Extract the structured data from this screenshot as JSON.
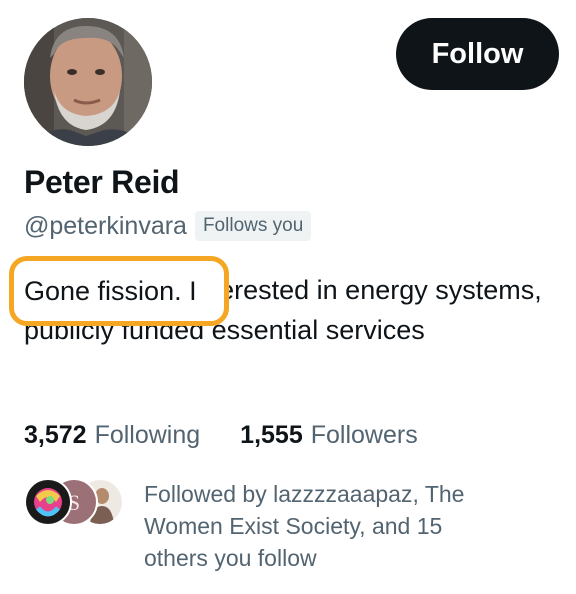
{
  "profile": {
    "display_name": "Peter Reid",
    "handle": "@peterkinvara",
    "follows_you_badge": "Follows you",
    "bio": "Gone fission. Interested in energy systems, publicly funded essential services",
    "highlight_text": "Gone fission. I",
    "avatar_icon": "profile-photo"
  },
  "actions": {
    "follow_label": "Follow"
  },
  "stats": {
    "following_count": "3,572",
    "following_label": "Following",
    "followers_count": "1,555",
    "followers_label": "Followers"
  },
  "mutuals": {
    "text": "Followed by lazzzzaaapaz, The Women Exist Society, and 15 others you follow"
  },
  "colors": {
    "button_bg": "#0f1419",
    "secondary_text": "#536471",
    "highlight": "#f5a623"
  }
}
